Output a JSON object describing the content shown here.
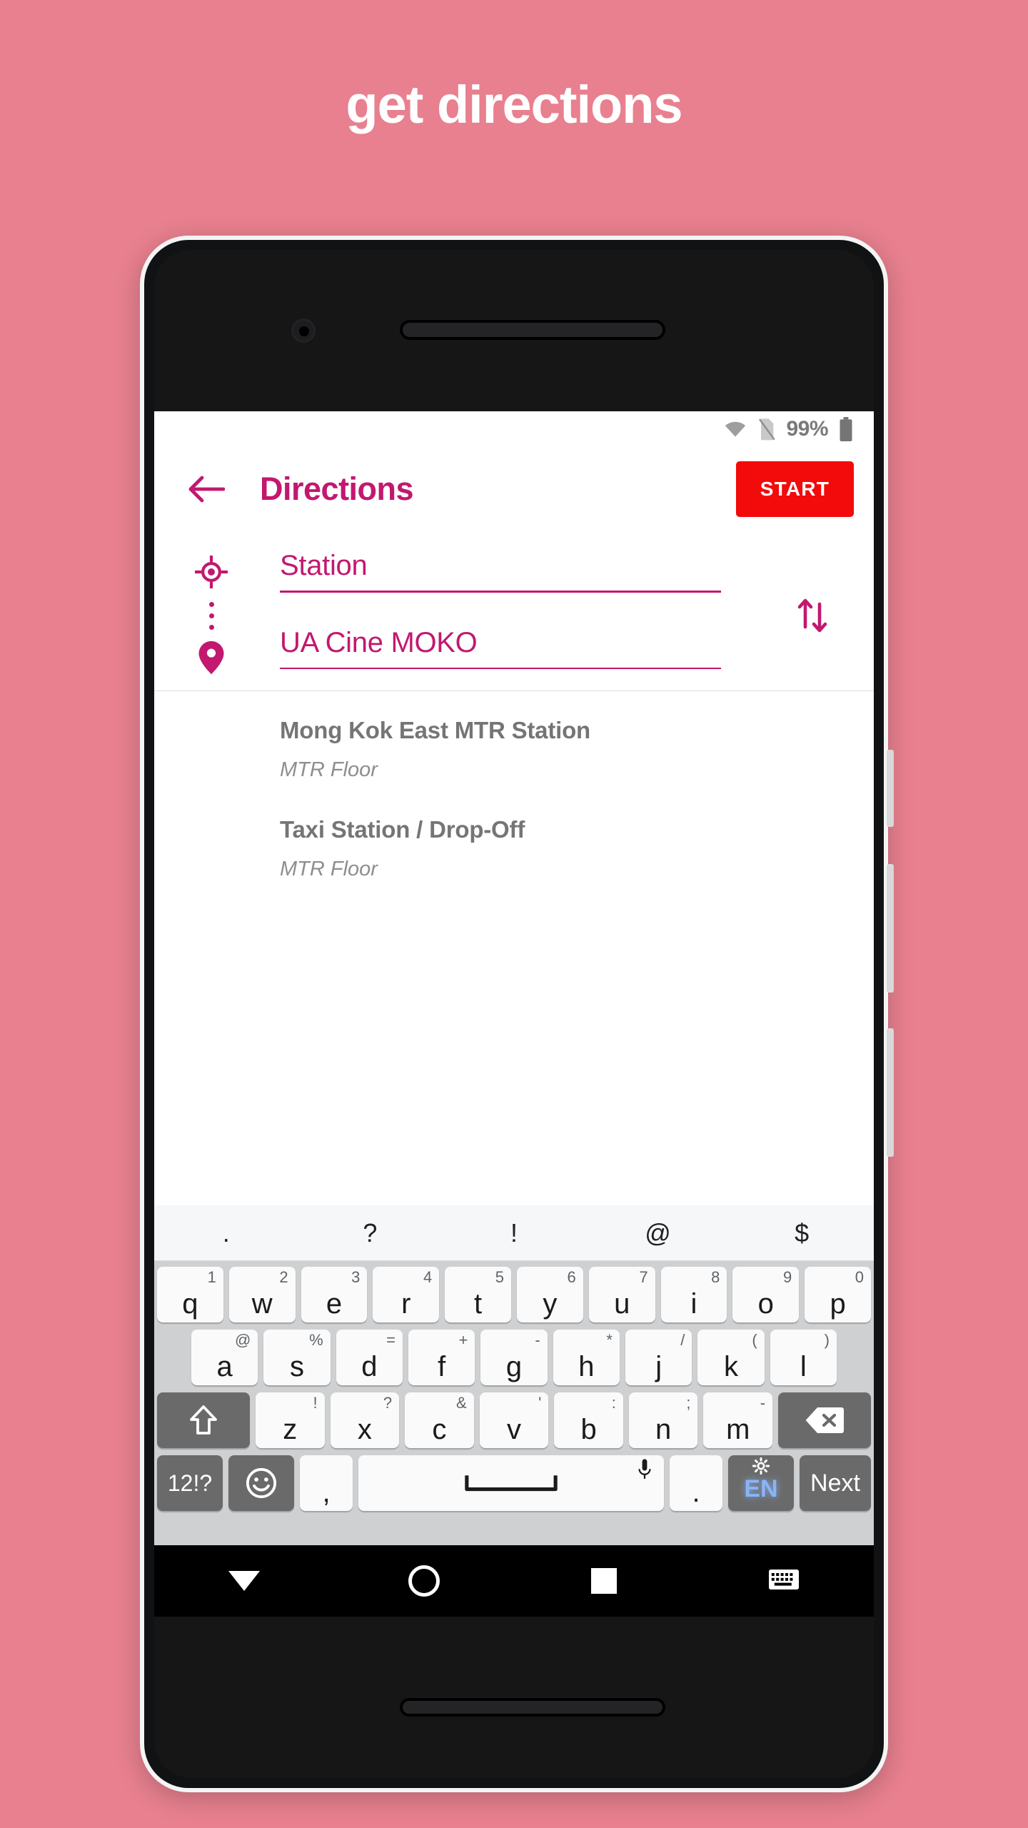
{
  "promo": {
    "title": "get directions"
  },
  "status_bar": {
    "wifi_icon": "wifi-icon",
    "sim_icon": "no-sim-icon",
    "battery_percent": "99%",
    "battery_icon": "battery-full-icon"
  },
  "app_bar": {
    "back_icon": "back-arrow-icon",
    "title": "Directions",
    "start_label": "START",
    "title_color": "#c2186f",
    "start_bg": "#f30a0a"
  },
  "route": {
    "origin_icon": "my-location-icon",
    "destination_icon": "map-pin-icon",
    "swap_icon": "swap-vertical-icon",
    "origin_value": "Station",
    "destination_value": "UA Cine MOKO",
    "accent_color": "#c2186f"
  },
  "suggestions": [
    {
      "title": "Mong Kok East MTR Station",
      "subtitle": "MTR Floor"
    },
    {
      "title": "Taxi Station / Drop-Off",
      "subtitle": "MTR Floor"
    }
  ],
  "keyboard": {
    "suggestion_strip": [
      ".",
      "?",
      "!",
      "@",
      "$"
    ],
    "row1": [
      {
        "main": "q",
        "sup": "1"
      },
      {
        "main": "w",
        "sup": "2"
      },
      {
        "main": "e",
        "sup": "3"
      },
      {
        "main": "r",
        "sup": "4"
      },
      {
        "main": "t",
        "sup": "5"
      },
      {
        "main": "y",
        "sup": "6"
      },
      {
        "main": "u",
        "sup": "7"
      },
      {
        "main": "i",
        "sup": "8"
      },
      {
        "main": "o",
        "sup": "9"
      },
      {
        "main": "p",
        "sup": "0"
      }
    ],
    "row2": [
      {
        "main": "a",
        "sup": "@"
      },
      {
        "main": "s",
        "sup": "%"
      },
      {
        "main": "d",
        "sup": "="
      },
      {
        "main": "f",
        "sup": "+"
      },
      {
        "main": "g",
        "sup": "-"
      },
      {
        "main": "h",
        "sup": "*"
      },
      {
        "main": "j",
        "sup": "/"
      },
      {
        "main": "k",
        "sup": "("
      },
      {
        "main": "l",
        "sup": ")"
      }
    ],
    "row3": [
      {
        "main": "z",
        "sup": "!"
      },
      {
        "main": "x",
        "sup": "?"
      },
      {
        "main": "c",
        "sup": "&"
      },
      {
        "main": "v",
        "sup": "'"
      },
      {
        "main": "b",
        "sup": ":"
      },
      {
        "main": "n",
        "sup": ";"
      },
      {
        "main": "m",
        "sup": "-"
      }
    ],
    "shift_icon": "shift-arrow-icon",
    "backspace_icon": "backspace-icon",
    "numbers_label": "12!?",
    "emoji_icon": "emoji-smiley-icon",
    "comma_label": ",",
    "space_icon": "space-bar-icon",
    "mic_icon": "microphone-icon",
    "period_label": ".",
    "language_label": "EN",
    "settings_icon": "gear-icon",
    "next_label": "Next"
  },
  "nav_bar": {
    "back_icon": "keyboard-hide-down-icon",
    "home_icon": "home-circle-icon",
    "recents_icon": "recents-square-icon",
    "keyboard_icon": "keyboard-icon"
  }
}
